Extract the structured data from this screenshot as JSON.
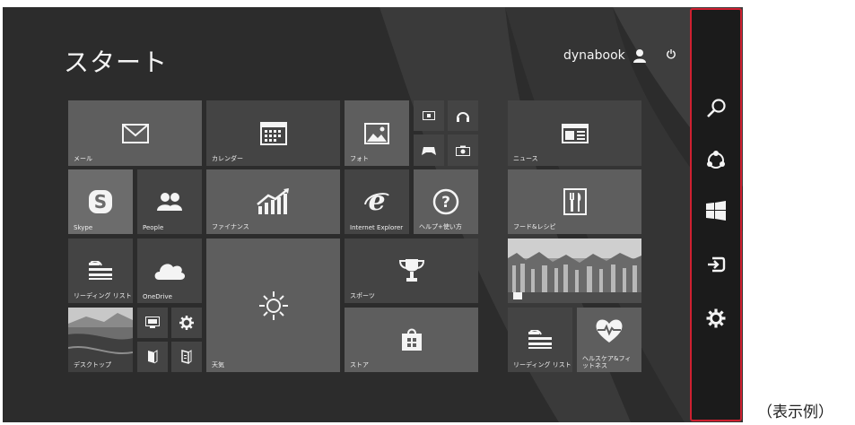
{
  "start": {
    "title": "スタート",
    "user_name": "dynabook"
  },
  "tiles": {
    "mail": "メール",
    "calendar": "カレンダー",
    "photos": "フォト",
    "news": "ニュース",
    "skype": "Skype",
    "people": "People",
    "finance": "ファイナンス",
    "ie": "Internet Explorer",
    "help": "ヘルプ+使い方",
    "food": "フード&レシピ",
    "reading_list": "リーディング リスト",
    "onedrive": "OneDrive",
    "sports": "スポーツ",
    "desktop": "デスクトップ",
    "weather": "天気",
    "store": "ストア",
    "reading_list_2": "リーディング リスト",
    "health": "ヘルスケア&フィットネス"
  },
  "charms": [
    "search-icon",
    "share-icon",
    "windows-start-icon",
    "devices-icon",
    "settings-icon"
  ],
  "caption": "（表示例）",
  "colors": {
    "charm_border": "#cf2030",
    "background": "#2c2c2c"
  }
}
